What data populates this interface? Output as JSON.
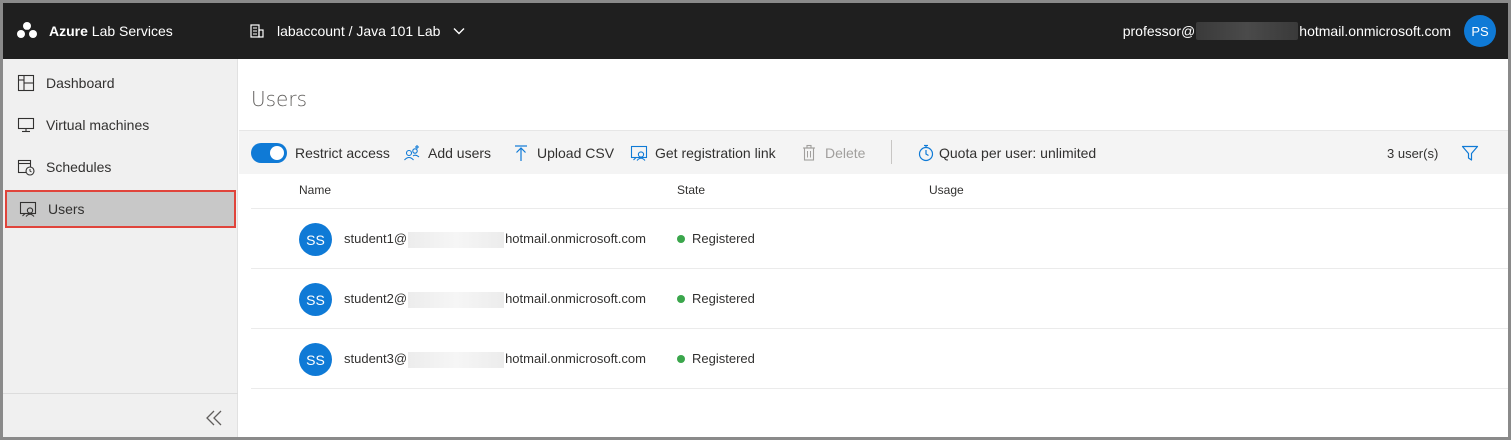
{
  "header": {
    "brand_bold": "Azure",
    "brand_rest": " Lab Services",
    "lab_path": "labaccount / Java 101 Lab",
    "account_prefix": "professor@",
    "account_suffix": "hotmail.onmicrosoft.com",
    "avatar_initials": "PS"
  },
  "sidebar": {
    "items": [
      {
        "label": "Dashboard",
        "icon": "dashboard-icon"
      },
      {
        "label": "Virtual machines",
        "icon": "monitor-icon"
      },
      {
        "label": "Schedules",
        "icon": "calendar-clock-icon"
      },
      {
        "label": "Users",
        "icon": "users-icon",
        "active": true
      }
    ],
    "collapse_icon": "double-chevron-left-icon"
  },
  "main": {
    "title": "Users",
    "toolbar": {
      "restrict_access": "Restrict access",
      "restrict_access_on": true,
      "add_users": "Add users",
      "upload_csv": "Upload CSV",
      "get_registration_link": "Get registration link",
      "delete": "Delete",
      "quota": "Quota per user: unlimited",
      "user_count": "3 user(s)"
    },
    "columns": [
      "Name",
      "State",
      "Usage"
    ],
    "users": [
      {
        "initials": "SS",
        "email_prefix": "student1@",
        "email_suffix": "hotmail.onmicrosoft.com",
        "state": "Registered",
        "usage": ""
      },
      {
        "initials": "SS",
        "email_prefix": "student2@",
        "email_suffix": "hotmail.onmicrosoft.com",
        "state": "Registered",
        "usage": ""
      },
      {
        "initials": "SS",
        "email_prefix": "student3@",
        "email_suffix": "hotmail.onmicrosoft.com",
        "state": "Registered",
        "usage": ""
      }
    ]
  },
  "colors": {
    "topbar": "#1f1f1f",
    "accent": "#0f7ad6",
    "registered": "#3ba64c",
    "active_outline": "#e0443b"
  }
}
